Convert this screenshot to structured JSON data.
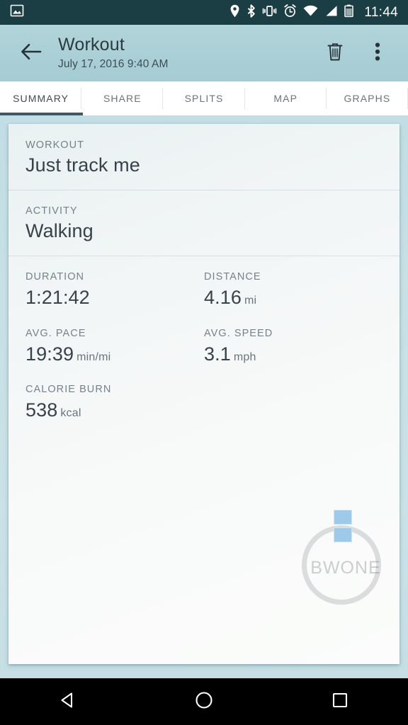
{
  "status_bar": {
    "time": "11:44",
    "left_icons": [
      "image-icon"
    ],
    "right_icons": [
      "location-icon",
      "bluetooth-icon",
      "vibrate-icon",
      "alarm-icon",
      "wifi-icon",
      "signal-icon",
      "battery-icon"
    ],
    "background_color": "#1b3d44",
    "foreground_color": "#ffffff"
  },
  "app_bar": {
    "back_label": "back-arrow",
    "title": "Workout",
    "subtitle": "July 17, 2016 9:40 AM",
    "delete_label": "delete",
    "overflow_label": "more options",
    "background_color": "#aacfd6",
    "text_color": "#2b3a40"
  },
  "tabs": {
    "active_index": 0,
    "indicator_color": "#3d5b66",
    "items": [
      {
        "label": "SUMMARY"
      },
      {
        "label": "SHARE"
      },
      {
        "label": "SPLITS"
      },
      {
        "label": "MAP"
      },
      {
        "label": "GRAPHS"
      }
    ]
  },
  "summary": {
    "workout": {
      "label": "WORKOUT",
      "value": "Just track me"
    },
    "activity": {
      "label": "ACTIVITY",
      "value": "Walking"
    },
    "metrics": [
      {
        "label": "DURATION",
        "value": "1:21:42",
        "unit": ""
      },
      {
        "label": "DISTANCE",
        "value": "4.16",
        "unit": "mi"
      },
      {
        "label": "AVG. PACE",
        "value": "19:39",
        "unit": "min/mi"
      },
      {
        "label": "AVG. SPEED",
        "value": "3.1",
        "unit": "mph"
      },
      {
        "label": "CALORIE BURN",
        "value": "538",
        "unit": "kcal"
      }
    ]
  },
  "watermark": {
    "text": "BWONE",
    "subtext": "",
    "logo_color": "#9fc9e8"
  },
  "nav_bar": {
    "back": "back-triangle",
    "home": "home-circle",
    "recents": "recents-square",
    "background_color": "#000000"
  }
}
